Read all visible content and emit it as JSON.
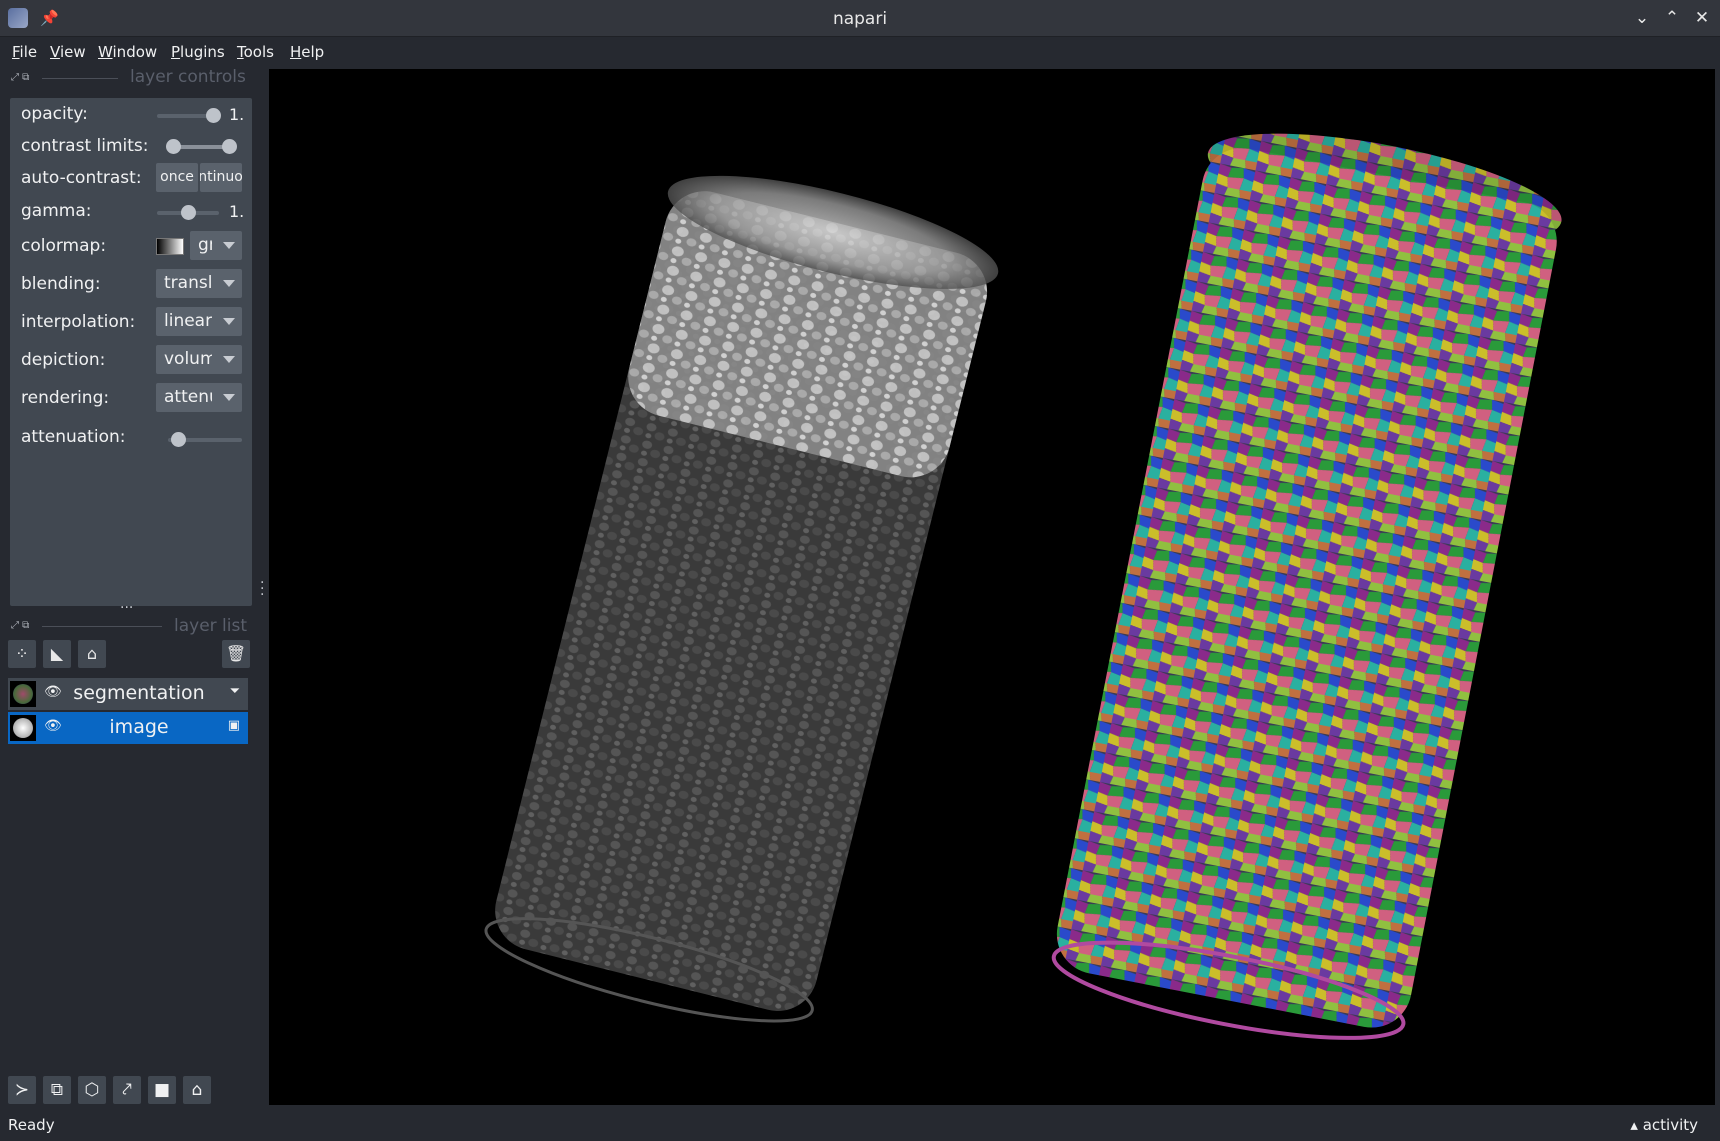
{
  "window": {
    "title": "napari"
  },
  "menu": [
    {
      "label": "File",
      "key": "F",
      "rest": "ile"
    },
    {
      "label": "View",
      "key": "V",
      "rest": "iew"
    },
    {
      "label": "Window",
      "key": "W",
      "rest": "indow"
    },
    {
      "label": "Plugins",
      "key": "P",
      "rest": "lugins"
    },
    {
      "label": "Tools",
      "key": "T",
      "rest": "ools"
    },
    {
      "label": "Help",
      "key": "H",
      "rest": "elp"
    }
  ],
  "layer_controls": {
    "title": "layer controls",
    "opacity": {
      "label": "opacity:",
      "value": "1.",
      "fraction": 1.0
    },
    "contrast_limits": {
      "label": "contrast limits:",
      "low_fraction": 0.0,
      "high_fraction": 1.0
    },
    "auto_contrast": {
      "label": "auto-contrast:",
      "once": "once",
      "continuous": "continuous"
    },
    "gamma": {
      "label": "gamma:",
      "value": "1.",
      "fraction": 0.5
    },
    "colormap": {
      "label": "colormap:",
      "value": "gray"
    },
    "blending": {
      "label": "blending:",
      "value": "translucent"
    },
    "interpolation": {
      "label": "interpolation:",
      "value": "linear"
    },
    "depiction": {
      "label": "depiction:",
      "value": "volume"
    },
    "rendering": {
      "label": "rendering:",
      "value": "attenuated_mip"
    },
    "attenuation": {
      "label": "attenuation:",
      "fraction": 0.05
    }
  },
  "layer_list": {
    "title": "layer list",
    "layers": [
      {
        "name": "segmentation",
        "type": "labels",
        "selected": false
      },
      {
        "name": "image",
        "type": "image",
        "selected": true
      }
    ]
  },
  "status": {
    "text": "Ready",
    "activity": "activity"
  },
  "icons": {
    "points": "new-points-icon",
    "shapes": "new-shapes-icon",
    "labels": "new-labels-icon",
    "delete": "delete-layer-icon",
    "console": "console-icon",
    "ndisplay": "ndisplay-toggle-icon",
    "roll": "roll-dims-icon",
    "transpose": "transpose-dims-icon",
    "grid": "grid-mode-icon",
    "home": "home-icon"
  },
  "colors": {
    "selected": "#0967c4",
    "panel": "#262930",
    "widget": "#414851",
    "canvas": "#000000"
  }
}
